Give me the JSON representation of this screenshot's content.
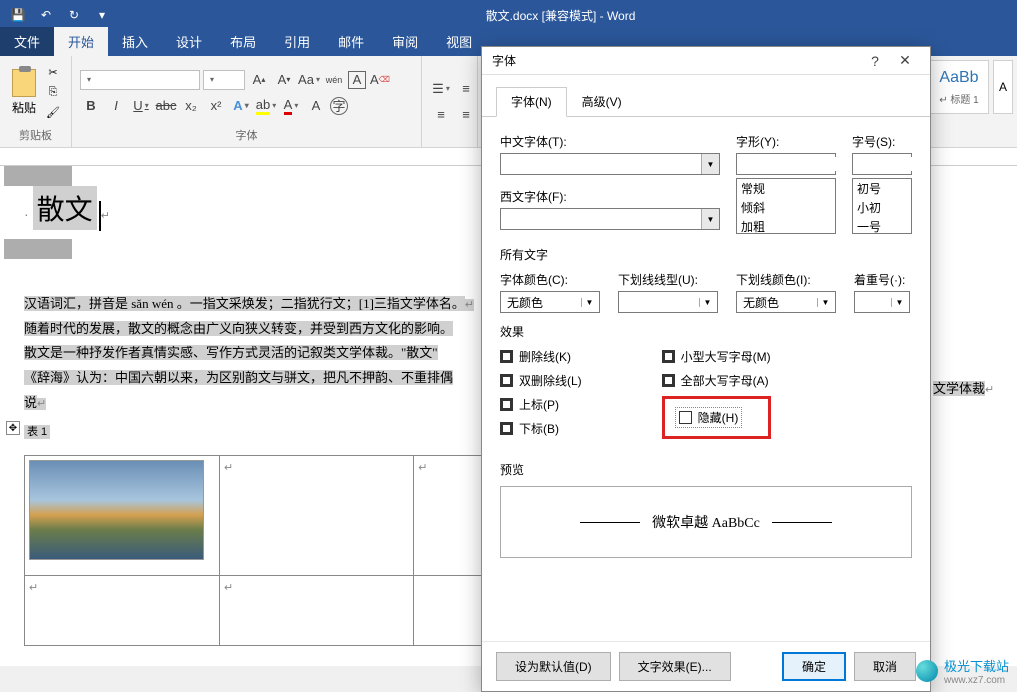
{
  "titlebar": {
    "title": "散文.docx [兼容模式] - Word"
  },
  "menu": {
    "file": "文件",
    "home": "开始",
    "insert": "插入",
    "design": "设计",
    "layout": "布局",
    "references": "引用",
    "mailings": "邮件",
    "review": "审阅",
    "view": "视图"
  },
  "ribbon": {
    "paste": "粘贴",
    "clipboard": "剪贴板",
    "font_group": "字体",
    "bold": "B",
    "italic": "I",
    "underline": "U",
    "strike": "abc",
    "sub": "x₂",
    "sup": "x²",
    "aa": "Aa",
    "clear": "A",
    "wen": "wén",
    "style_preview": "AaBb",
    "style_name": "↵ 标题 1"
  },
  "document": {
    "title": "散文",
    "para1": "汉语词汇，拼音是 sǎn wén 。一指文采焕发；二指犹行文；[1]三指文学体名。",
    "para2": "随着时代的发展，散文的概念由广义向狭义转变，并受到西方文化的影响。",
    "para3": "散文是一种抒发作者真情实感、写作方式灵活的记叙类文学体裁。\"散文\"",
    "para4": "《辞海》认为：中国六朝以来，为区别韵文与骈文，把凡不押韵、不重排偶",
    "para5": "说",
    "behind": "文学体裁",
    "table_label": "表 1"
  },
  "dialog": {
    "title": "字体",
    "tab_font": "字体(N)",
    "tab_advanced": "高级(V)",
    "cn_font_label": "中文字体(T):",
    "en_font_label": "西文字体(F):",
    "style_label": "字形(Y):",
    "size_label": "字号(S):",
    "style_regular": "常规",
    "style_italic": "倾斜",
    "style_bold": "加粗",
    "size_chu": "初号",
    "size_xiaochu": "小初",
    "size_yi": "一号",
    "all_text": "所有文字",
    "font_color_label": "字体颜色(C):",
    "underline_style_label": "下划线线型(U):",
    "underline_color_label": "下划线颜色(I):",
    "emphasis_label": "着重号(·):",
    "no_color": "无颜色",
    "effects": "效果",
    "strike": "删除线(K)",
    "dstrike": "双删除线(L)",
    "superscript": "上标(P)",
    "subscript": "下标(B)",
    "smallcaps": "小型大写字母(M)",
    "allcaps": "全部大写字母(A)",
    "hidden": "隐藏(H)",
    "preview": "预览",
    "preview_text": "微软卓越  AaBbCc",
    "set_default": "设为默认值(D)",
    "text_effects": "文字效果(E)...",
    "ok": "确定",
    "cancel": "取消"
  },
  "watermark": {
    "text": "极光下载站",
    "url": "www.xz7.com"
  }
}
